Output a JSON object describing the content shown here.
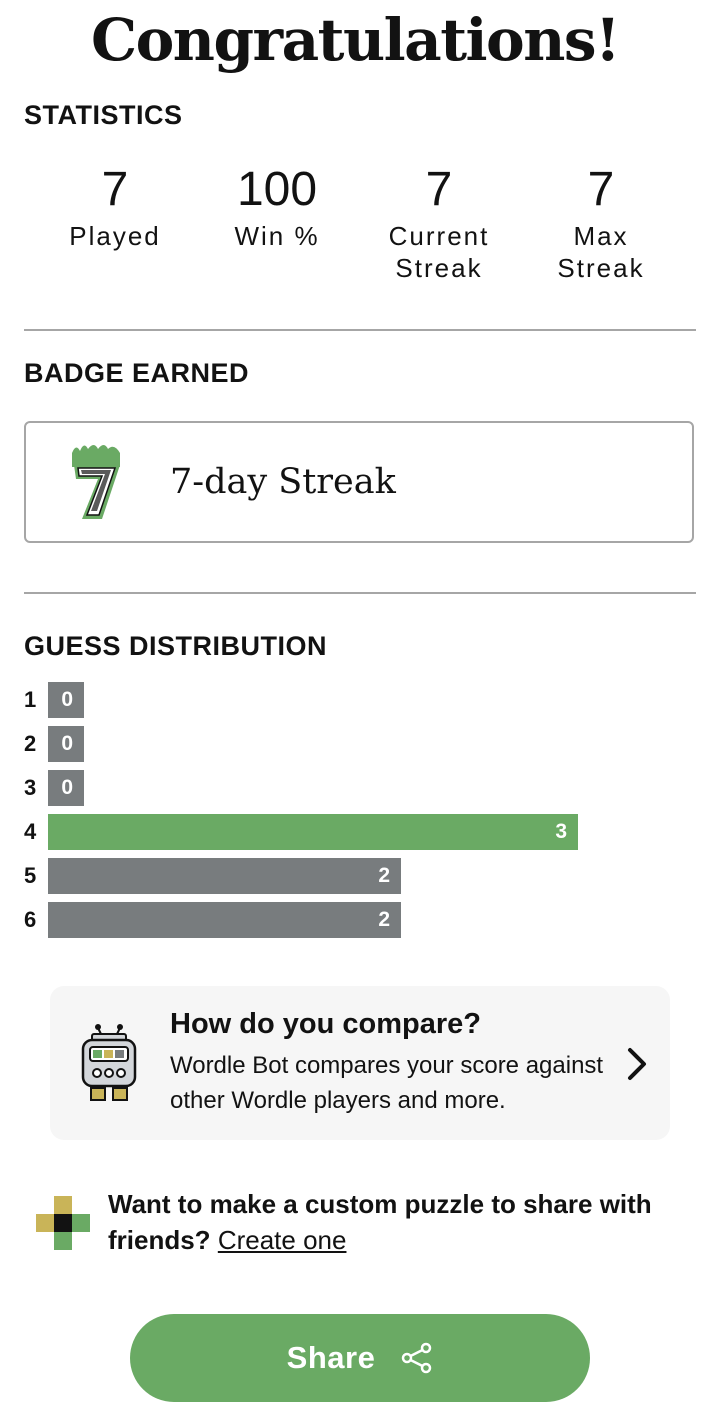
{
  "header": {
    "title": "Congratulations!"
  },
  "statistics": {
    "heading": "STATISTICS",
    "items": [
      {
        "value": "7",
        "label": "Played"
      },
      {
        "value": "100",
        "label": "Win %"
      },
      {
        "value": "7",
        "label": "Current\nStreak"
      },
      {
        "value": "7",
        "label": "Max\nStreak"
      }
    ]
  },
  "badge": {
    "heading": "BADGE EARNED",
    "icon": "seven-streak-badge-icon",
    "label": "7-day Streak"
  },
  "guess_distribution": {
    "heading": "GUESS DISTRIBUTION",
    "rows": [
      {
        "guess": "1",
        "count": 0,
        "highlight": false
      },
      {
        "guess": "2",
        "count": 0,
        "highlight": false
      },
      {
        "guess": "3",
        "count": 0,
        "highlight": false
      },
      {
        "guess": "4",
        "count": 3,
        "highlight": true
      },
      {
        "guess": "5",
        "count": 2,
        "highlight": false
      },
      {
        "guess": "6",
        "count": 2,
        "highlight": false
      }
    ]
  },
  "compare": {
    "icon": "wordle-bot-icon",
    "title": "How do you compare?",
    "description": "Wordle Bot compares your score against other Wordle players and more."
  },
  "custom_puzzle": {
    "icon": "custom-puzzle-icon",
    "text": "Want to make a custom puzzle to share with friends?",
    "link": "Create one"
  },
  "share": {
    "label": "Share",
    "icon": "share-icon"
  },
  "colors": {
    "correct_green": "#6aaa64",
    "absent_gray": "#787c7e",
    "present_yellow": "#c9b458",
    "divider": "#a6a6a6",
    "card_bg": "#f6f6f6"
  }
}
